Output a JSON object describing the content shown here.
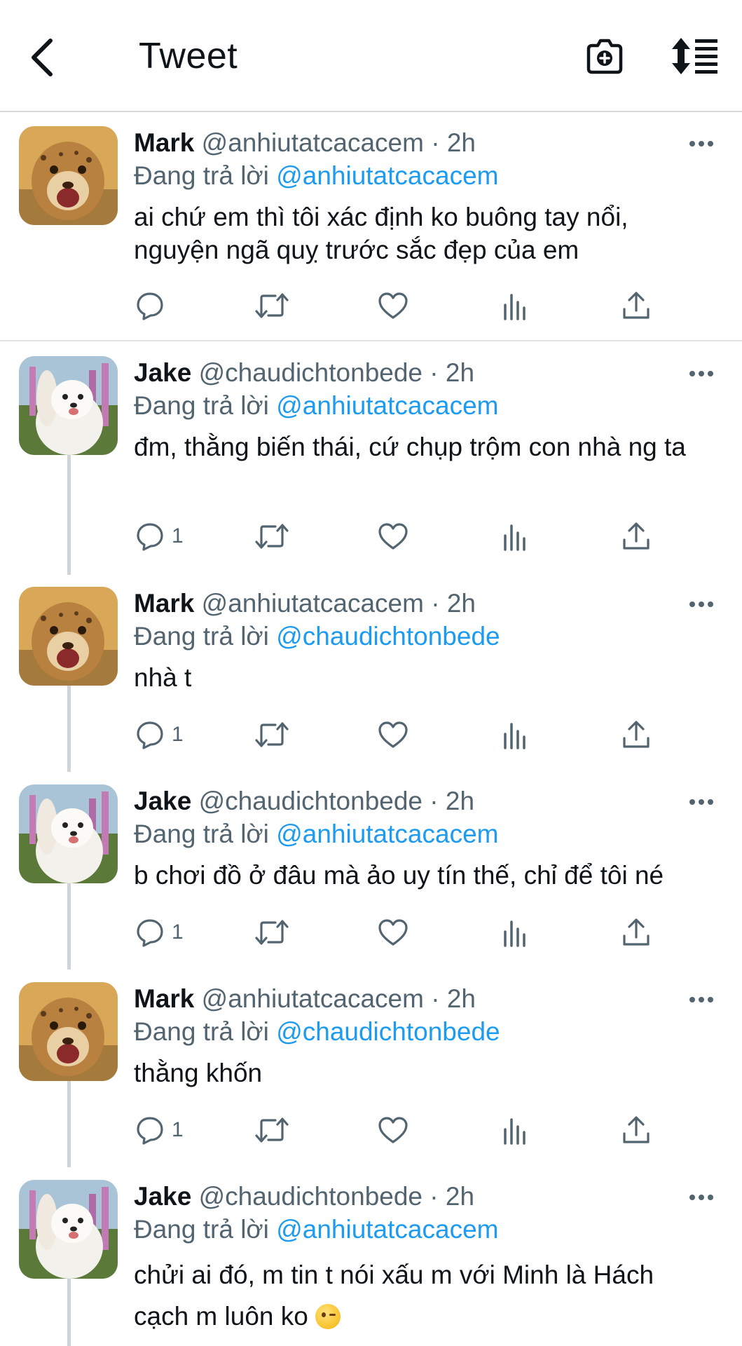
{
  "header": {
    "title": "Tweet"
  },
  "tweets": [
    {
      "name": "Mark",
      "handle": "@anhiutatcacacem",
      "time": "· 2h",
      "reply_prefix": "Đang trả lời",
      "reply_to": "@anhiutatcacacem",
      "text": "ai chứ em thì tôi xác định ko buông tay nổi, nguyện ngã quỵ trước sắc đẹp của em",
      "reply_count": "",
      "avatar": "cheetah-cub"
    },
    {
      "name": "Jake",
      "handle": "@chaudichtonbede",
      "time": "· 2h",
      "reply_prefix": "Đang trả lời",
      "reply_to": "@anhiutatcacacem",
      "text": "đm, thằng biến thái, cứ chụp trộm con nhà ng ta",
      "reply_count": "1",
      "avatar": "white-dog"
    },
    {
      "name": "Mark",
      "handle": "@anhiutatcacacem",
      "time": "· 2h",
      "reply_prefix": "Đang trả lời",
      "reply_to": "@chaudichtonbede",
      "text": "nhà t",
      "reply_count": "1",
      "avatar": "cheetah-cub"
    },
    {
      "name": "Jake",
      "handle": "@chaudichtonbede",
      "time": "· 2h",
      "reply_prefix": "Đang trả lời",
      "reply_to": "@anhiutatcacacem",
      "text": "b chơi đồ ở đâu mà ảo uy tín thế, chỉ để tôi né",
      "reply_count": "1",
      "avatar": "white-dog"
    },
    {
      "name": "Mark",
      "handle": "@anhiutatcacacem",
      "time": "· 2h",
      "reply_prefix": "Đang trả lời",
      "reply_to": "@chaudichtonbede",
      "text": "thằng khốn",
      "reply_count": "1",
      "avatar": "cheetah-cub"
    },
    {
      "name": "Jake",
      "handle": "@chaudichtonbede",
      "time": "· 2h",
      "reply_prefix": "Đang trả lời",
      "reply_to": "@anhiutatcacacem",
      "text": "chửi ai đó, m tin t nói xấu m với Minh là Hách cạch m luôn ko",
      "emoji": "winking-face",
      "reply_count": "",
      "avatar": "white-dog"
    }
  ],
  "colors": {
    "link": "#1d9bf0",
    "secondary": "#536471",
    "thread_line": "#cfd4d8"
  }
}
